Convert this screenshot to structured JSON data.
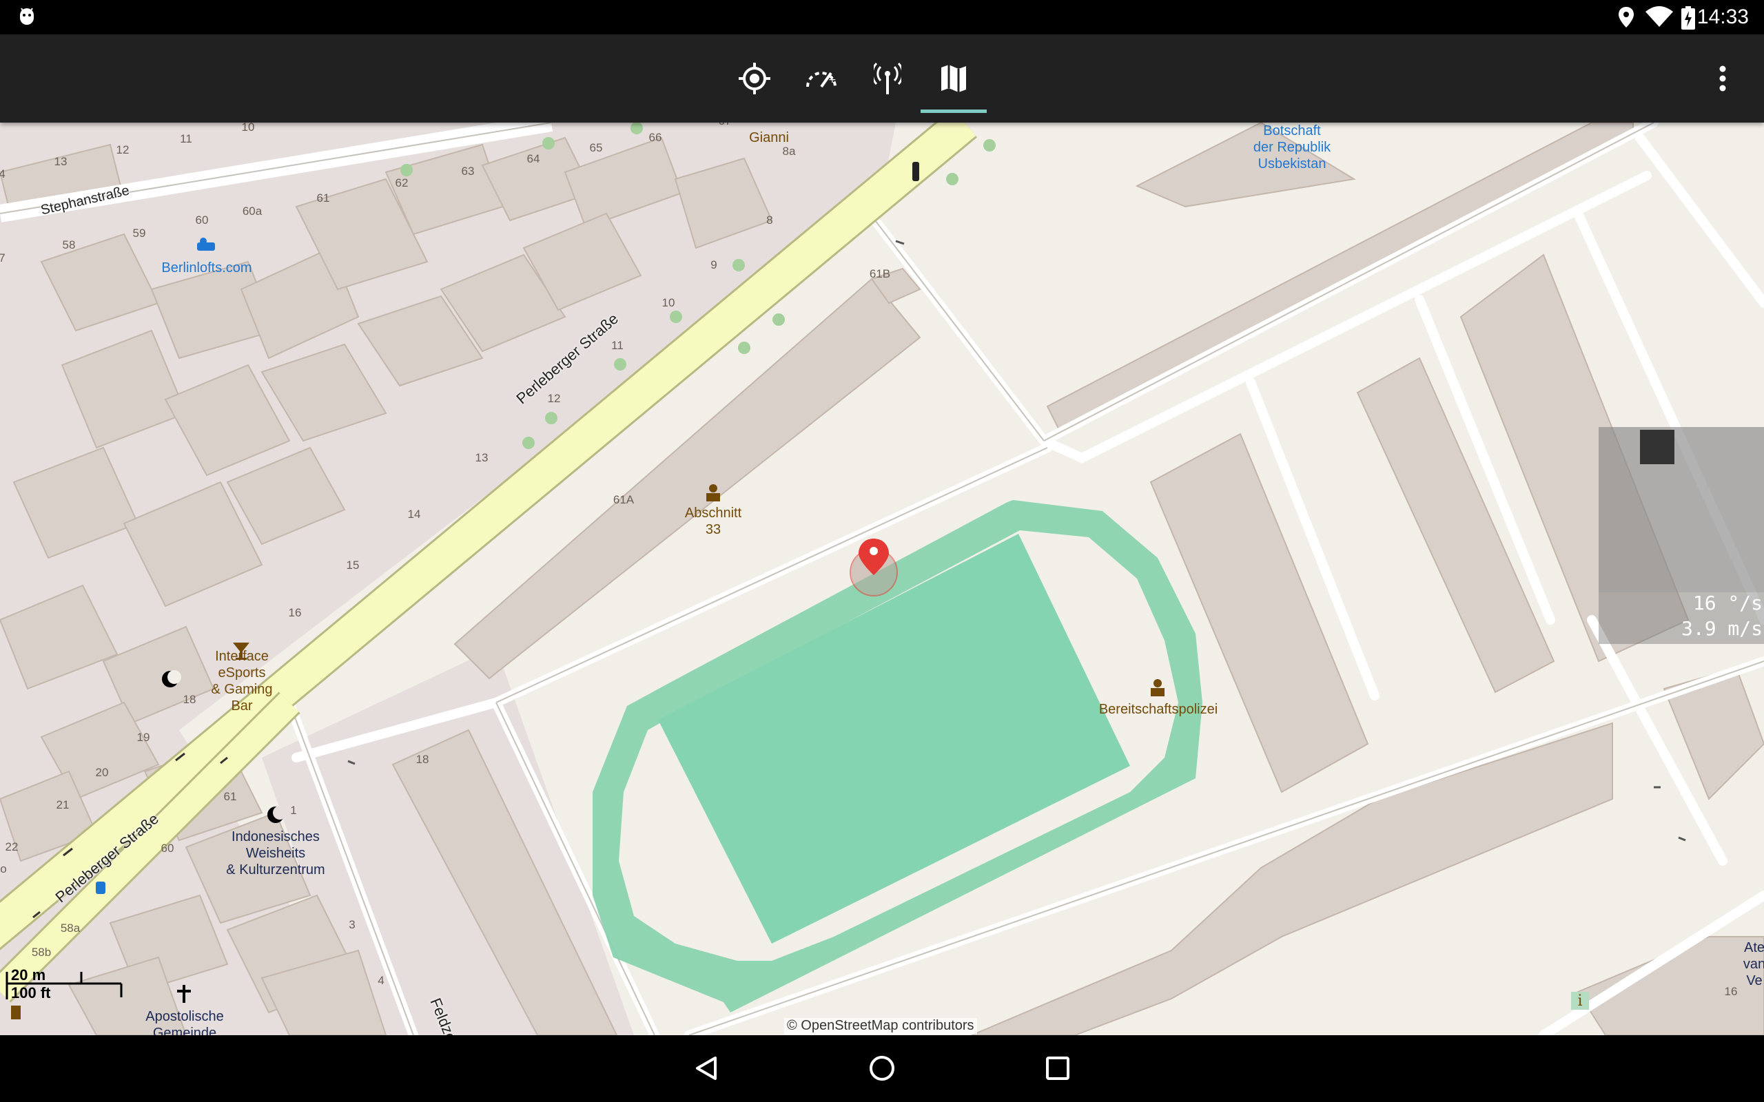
{
  "status_bar": {
    "time": "14:33",
    "icons": [
      "android-debug-icon",
      "location-icon",
      "wifi-icon",
      "battery-charging-icon"
    ]
  },
  "toolbar": {
    "tabs": [
      {
        "name": "gps-status-tab",
        "icon": "crosshair-icon",
        "selected": false
      },
      {
        "name": "speed-tab",
        "icon": "speedometer-icon",
        "selected": false
      },
      {
        "name": "signal-tab",
        "icon": "antenna-icon",
        "selected": false
      },
      {
        "name": "map-tab",
        "icon": "map-icon",
        "selected": true
      }
    ],
    "overflow_icon": "more-vert-icon",
    "accent_color": "#80cbc4"
  },
  "map": {
    "streets": [
      "Stephanstraße",
      "Perleberger Straße",
      "Perleberger Straße",
      "Feldze"
    ],
    "pois": {
      "gianni": "Gianni",
      "berlinlofts": "Berlinlofts.com",
      "botschaft": "Botschaft der Republik Usbekistan",
      "botschaft_l1": "Botschaft",
      "botschaft_l2": "der Republik",
      "botschaft_l3": "Usbekistan",
      "abschnitt_l1": "Abschnitt",
      "abschnitt_l2": "33",
      "interface_l1": "Interface",
      "interface_l2": "eSports",
      "interface_l3": "& Gaming",
      "interface_l4": "Bar",
      "bereitschaft": "Bereitschaftspolizei",
      "indo_l1": "Indonesisches",
      "indo_l2": "Weisheits",
      "indo_l3": "& Kulturzentrum",
      "apost_l1": "Apostolische",
      "apost_l2": "Gemeinde",
      "ate_l1": "Ate",
      "ate_l2": "van",
      "ate_l3": "Ve"
    },
    "house_numbers": {
      "n10": "10",
      "n13": "13",
      "n12": "12",
      "n11": "11",
      "n67": "67",
      "n66": "66",
      "n65": "65",
      "n64": "64",
      "n63": "63",
      "n62": "62",
      "n61": "61",
      "n60a": "60a",
      "n60": "60",
      "n59": "59",
      "n58": "58",
      "n8a": "8a",
      "n8": "8",
      "n9": "9",
      "n10b": "10",
      "n11b": "11",
      "n12b": "12",
      "n13b": "13",
      "n14": "14",
      "n15": "15",
      "n16": "16",
      "n18": "18",
      "n19": "19",
      "n20": "20",
      "n21": "21",
      "n22": "22",
      "n61B": "61B",
      "n61A": "61A",
      "n18b": "18",
      "n61b": "61",
      "n60b": "60",
      "n1": "1",
      "n58a": "58a",
      "n58b": "58b",
      "n3": "3",
      "n4": "4",
      "n16b": "16",
      "n4a": "4",
      "n7": "7",
      "n0": "o"
    },
    "scale": {
      "metric": "20 m",
      "imperial": "100 ft"
    },
    "attribution": "© OpenStreetMap contributors",
    "marker_color": "#e53935"
  },
  "sensor_overlay": {
    "rotation": "16 °/s",
    "speed": "3.9 m/s"
  },
  "nav_bar": {
    "buttons": [
      "back-icon",
      "home-icon",
      "recents-icon"
    ]
  }
}
